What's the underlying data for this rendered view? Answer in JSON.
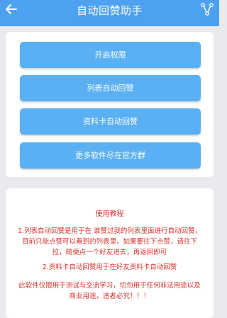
{
  "header": {
    "title": "自动回赞助手",
    "back_icon": "back-arrow-icon",
    "share_icon": "share-icon",
    "color": "#4ea1f1"
  },
  "buttons": [
    {
      "label": "开启权限"
    },
    {
      "label": "列表自动回赞"
    },
    {
      "label": "资料卡自动回赞"
    },
    {
      "label": "更多软件尽在官方群"
    }
  ],
  "tutorial": {
    "title": "使用教程",
    "paragraph1": "1.列表自动回赞是用于在 谁赞过我的列表里面进行自动回赞，目前只能点赞可以看到的列表里，如果要往下点赞，请往下拉，随便点一个好友进去，再返回即可",
    "paragraph2": "2.资料卡自动回赞用于在好友资料卡自动回赞",
    "disclaimer": "此软件仅限用于测试与交流学习，切勿用于任何非法用途以及商业用途，违者必究！！！",
    "text_color": "#d8312b"
  }
}
